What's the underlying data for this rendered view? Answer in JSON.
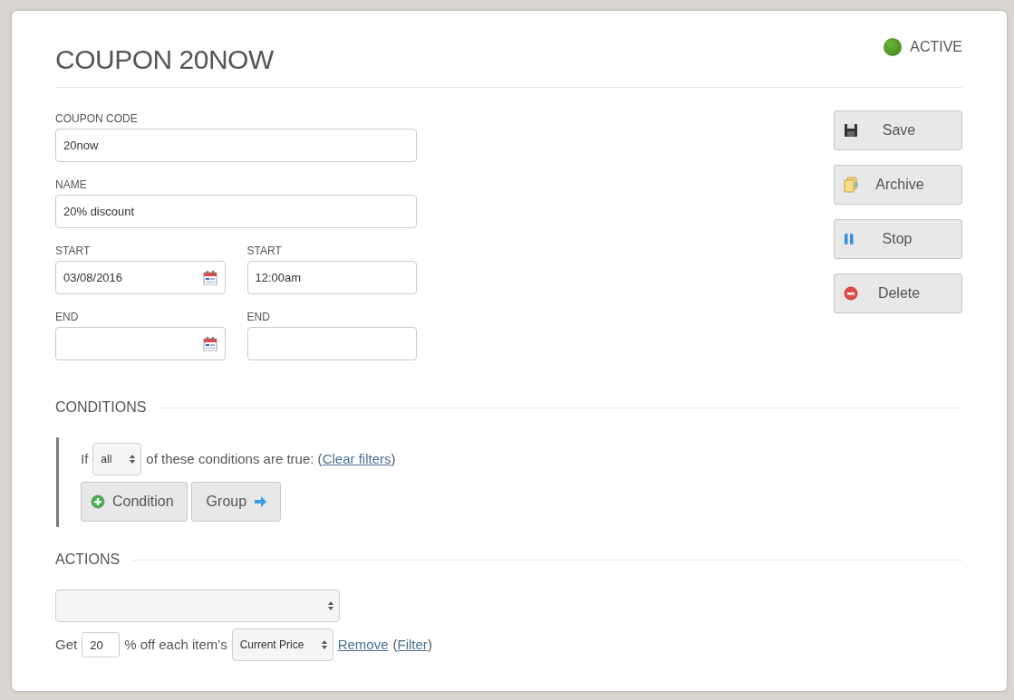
{
  "header": {
    "title": "COUPON 20NOW",
    "status": {
      "label": "ACTIVE",
      "active": true
    }
  },
  "form_rows": [
    [
      {
        "label": "COUPON CODE",
        "value": "20now",
        "kind": "text"
      }
    ],
    [
      {
        "label": "NAME",
        "value": "20% discount",
        "kind": "text"
      }
    ],
    [
      {
        "label": "START",
        "value": "03/08/2016",
        "kind": "date"
      },
      {
        "label": "START",
        "value": "12:00am",
        "kind": "text"
      }
    ],
    [
      {
        "label": "END",
        "kind": "date"
      },
      {
        "label": "END",
        "kind": "text"
      }
    ]
  ],
  "side_buttons": [
    {
      "label": "Save"
    },
    {
      "label": "Archive"
    },
    {
      "label": "Stop"
    },
    {
      "label": "Delete"
    }
  ],
  "conditions": {
    "heading": "CONDITIONS",
    "prefix": "If",
    "match": "all",
    "sentence": "of these conditions are true: (",
    "link": "Clear filters",
    "suffix": ")",
    "buttons": [
      {
        "label": "Condition"
      },
      {
        "label": "Group"
      }
    ]
  },
  "actions": {
    "heading": "ACTIONS",
    "get_label": "Get",
    "amount": "20",
    "middle": "% off each item's",
    "price_basis": "Current Price",
    "remove_link": "Remove",
    "filter_open": "(",
    "filter_link": "Filter",
    "filter_close": ")"
  }
}
